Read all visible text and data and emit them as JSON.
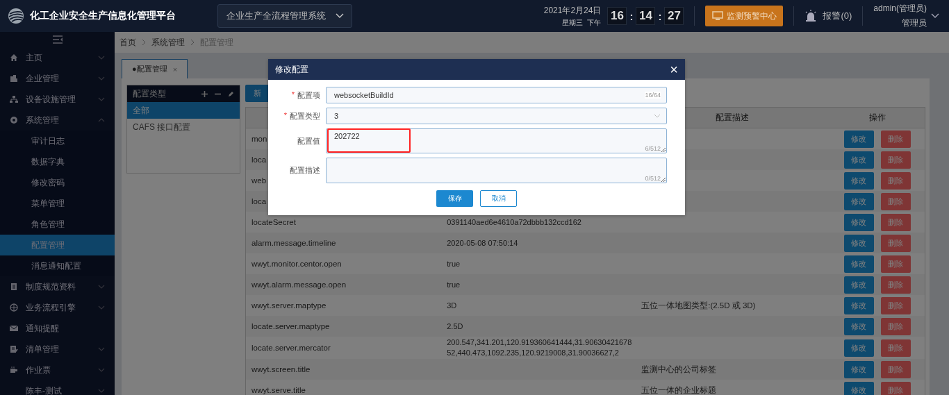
{
  "header": {
    "title": "化工企业安全生产信息化管理平台",
    "system": "企业生产全流程管理系统",
    "date": "2021年2月24日",
    "weekday": "星期三",
    "period": "下午",
    "clock": [
      "16",
      "14",
      "27"
    ],
    "clock_sep": ":",
    "monitor_button": "监测预警中心",
    "alarm": "报警(0)",
    "user": "admin(管理员)",
    "role": "管理员"
  },
  "sidebar": {
    "items": [
      {
        "label": "主页",
        "expanded": false,
        "chevron": true
      },
      {
        "label": "企业管理",
        "expanded": false,
        "chevron": true
      },
      {
        "label": "设备设施管理",
        "expanded": false,
        "chevron": true
      },
      {
        "label": "系统管理",
        "expanded": true,
        "chevron": true,
        "children": [
          {
            "label": "审计日志",
            "selected": false
          },
          {
            "label": "数据字典",
            "selected": false
          },
          {
            "label": "修改密码",
            "selected": false
          },
          {
            "label": "菜单管理",
            "selected": false
          },
          {
            "label": "角色管理",
            "selected": false
          },
          {
            "label": "配置管理",
            "selected": true
          },
          {
            "label": "消息通知配置",
            "selected": false
          }
        ]
      },
      {
        "label": "制度规范资料",
        "expanded": false,
        "chevron": true
      },
      {
        "label": "业务流程引擎",
        "expanded": false,
        "chevron": true
      },
      {
        "label": "通知提醒",
        "chevron": false
      },
      {
        "label": "清单管理",
        "expanded": false,
        "chevron": true
      },
      {
        "label": "作业票",
        "expanded": false,
        "chevron": true
      },
      {
        "label": "陈丰-测试",
        "expanded": false,
        "chevron": true
      }
    ]
  },
  "breadcrumb": [
    "首页",
    "系统管理",
    "配置管理"
  ],
  "tabs": [
    {
      "label": "●配置管理",
      "selected": true,
      "close": "×"
    }
  ],
  "type_tree": {
    "title": "配置类型",
    "items": [
      {
        "label": "全部",
        "selected": true
      },
      {
        "label": "CAFS 接口配置",
        "selected": false
      }
    ]
  },
  "add_button": "新",
  "table": {
    "columns": [
      {
        "label": "配置描述"
      },
      {
        "label": "操作"
      }
    ],
    "rows": [
      {
        "key": "mon",
        "edit": "修改",
        "delete": "删除"
      },
      {
        "key": "loca",
        "edit": "修改",
        "delete": "删除"
      },
      {
        "key": "web",
        "edit": "修改",
        "delete": "删除"
      },
      {
        "key": "loca",
        "edit": "修改",
        "delete": "删除"
      },
      {
        "key": "locateSecret",
        "value": "0391140aed6e4610a72dbbb132ccd162",
        "edit": "修改",
        "delete": "删除"
      },
      {
        "key": "alarm.message.timeline",
        "value": "2020-05-08 07:50:14",
        "edit": "修改",
        "delete": "删除"
      },
      {
        "key": "wwyt.monitor.centor.open",
        "value": "true",
        "edit": "修改",
        "delete": "删除"
      },
      {
        "key": "wwyt.alarm.message.open",
        "value": "true",
        "edit": "修改",
        "delete": "删除"
      },
      {
        "key": "wwyt.server.maptype",
        "value": "3D",
        "description": "五位一体地图类型:(2.5D 或 3D)",
        "edit": "修改",
        "delete": "删除"
      },
      {
        "key": "locate.server.maptype",
        "value": "2.5D",
        "edit": "修改",
        "delete": "删除"
      },
      {
        "key": "locate.server.mercator",
        "value": "200.547,341.201,120.919360641444,31.9063042167852,440.473,1092.235,120.9219008,31.90036627,2",
        "edit": "修改",
        "delete": "删除"
      },
      {
        "key": "wwyt.screen.title",
        "description": "监测中心的公司标签",
        "edit": "修改",
        "delete": "删除"
      },
      {
        "key": "wwyt.serve.title",
        "description": "五位一体的企业标题",
        "edit": "修改",
        "delete": "删除"
      }
    ]
  },
  "dialog": {
    "title": "修改配置",
    "close": "×",
    "fields": [
      {
        "kind": "input",
        "label": "配置项",
        "required": true,
        "value": "websocketBuildId",
        "count": "16/64"
      },
      {
        "kind": "select",
        "label": "配置类型",
        "required": true,
        "value": "3"
      },
      {
        "kind": "textarea",
        "label": "配置值",
        "required": false,
        "value": "202722",
        "count": "6/512",
        "highlighted": true
      },
      {
        "kind": "textarea",
        "label": "配置描述",
        "required": false,
        "count": "0/512",
        "highlighted": false
      }
    ],
    "required_mark": "*",
    "buttons": [
      {
        "label": "保存",
        "kind": "primary"
      },
      {
        "label": "取消",
        "kind": "plain"
      }
    ]
  }
}
